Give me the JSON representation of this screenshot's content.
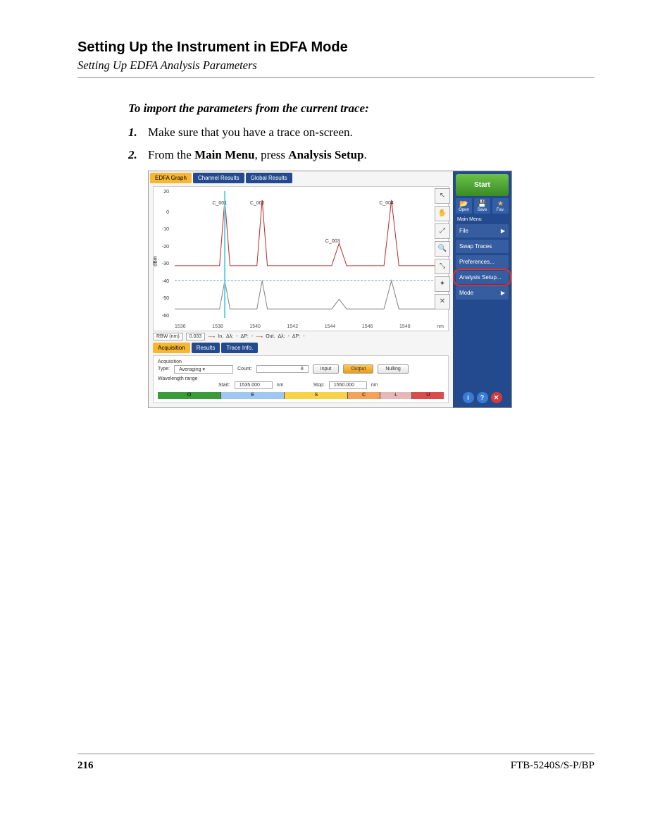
{
  "heading": "Setting Up the Instrument in EDFA Mode",
  "subheading": "Setting Up EDFA Analysis Parameters",
  "intro": "To import the parameters from the current trace:",
  "steps": [
    {
      "num": "1.",
      "plain": "Make sure that you have a trace on-screen."
    },
    {
      "num": "2.",
      "pre": "From the ",
      "b1": "Main Menu",
      "mid": ", press ",
      "b2": "Analysis Setup",
      "post": "."
    }
  ],
  "screenshot": {
    "tabs": {
      "edfa": "EDFA Graph",
      "channel": "Channel Results",
      "global": "Global Results"
    },
    "graph": {
      "ylabel": "dBm",
      "yticks": [
        "20",
        "0",
        "-10",
        "-20",
        "-30",
        "-40",
        "-50",
        "-60"
      ],
      "xticks": [
        "1536",
        "1538",
        "1540",
        "1542",
        "1544",
        "1546",
        "1548",
        "nm"
      ],
      "peaks": [
        "C_001",
        "C_002",
        "C_003",
        "C_004"
      ]
    },
    "readout": {
      "rbw_label": "RBW (nm)",
      "rbw_value": "0.033",
      "in": "In.",
      "out": "Out.",
      "dl": "Δλ:",
      "dp": "ΔP:",
      "dash": "-"
    },
    "bottom_tabs": {
      "acq": "Acquisition",
      "res": "Results",
      "trace": "Trace Info."
    },
    "acquisition": {
      "title": "Acquisition",
      "type_label": "Type:",
      "type_value": "Averaging",
      "count_label": "Count:",
      "count_value": "8",
      "input": "Input",
      "output": "Output",
      "nulling": "Nulling",
      "wl_label": "Wavelength range",
      "start_label": "Start:",
      "start_value": "1535.000",
      "stop_label": "Stop:",
      "stop_value": "1550.000",
      "unit": "nm",
      "bands": [
        "O",
        "E",
        "S",
        "C",
        "L",
        "U"
      ]
    },
    "sidebar": {
      "start": "Start",
      "open": "Open",
      "save": "Save",
      "fav": "Fav.",
      "menu_title": "Main Menu",
      "file": "File",
      "swap": "Swap Traces",
      "prefs": "Preferences...",
      "analysis": "Analysis Setup...",
      "mode": "Mode"
    }
  },
  "footer": {
    "page": "216",
    "model": "FTB-5240S/S-P/BP"
  }
}
